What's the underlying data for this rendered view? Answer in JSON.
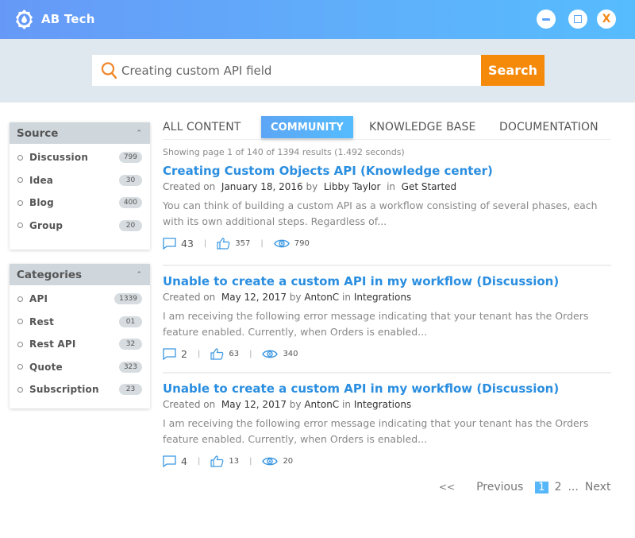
{
  "app": {
    "title": "AB Tech",
    "window_controls": {
      "minimize": "minimize",
      "maximize": "maximize",
      "close": "X"
    }
  },
  "search": {
    "value": "Creating custom API field",
    "button_label": "Search"
  },
  "sidebar": {
    "source": {
      "title": "Source",
      "items": [
        {
          "label": "Discussion",
          "count": "799"
        },
        {
          "label": "Idea",
          "count": "30"
        },
        {
          "label": "Blog",
          "count": "400"
        },
        {
          "label": "Group",
          "count": "20"
        }
      ]
    },
    "categories": {
      "title": "Categories",
      "items": [
        {
          "label": "API",
          "count": "1339"
        },
        {
          "label": "Rest",
          "count": "01"
        },
        {
          "label": "Rest API",
          "count": "32"
        },
        {
          "label": "Quote",
          "count": "323"
        },
        {
          "label": "Subscription",
          "count": "23"
        }
      ]
    }
  },
  "tabs": [
    {
      "label": "ALL CONTENT",
      "active": false
    },
    {
      "label": "COMMUNITY",
      "active": true
    },
    {
      "label": "KNOWLEDGE BASE",
      "active": false
    },
    {
      "label": "DOCUMENTATION",
      "active": false
    }
  ],
  "results_summary": "Showing page 1 of 140 of 1394 results (1.492 seconds)",
  "results": [
    {
      "title": "Creating Custom Objects API (Knowledge center)",
      "created_on_label": "Created on",
      "date": "January 18, 2016",
      "by_label": "by",
      "author": "Libby Taylor",
      "in_label": "in",
      "category": "Get Started",
      "snippet": "You can think of building a custom API as a workflow consisting of several phases, each with its own additional steps. Regardless of...",
      "comments": "43",
      "likes": "357",
      "views": "790"
    },
    {
      "title": "Unable to create a custom API in my workflow (Discussion)",
      "created_on_label": "Created on",
      "date": "May 12, 2017",
      "by_label": "by",
      "author": "AntonC",
      "in_label": "in",
      "category": "Integrations",
      "snippet": "I am receiving the following error message indicating that your tenant has the Orders feature enabled. Currently, when Orders is enabled...",
      "comments": "2",
      "likes": "63",
      "views": "340"
    },
    {
      "title": "Unable to create a custom API in my workflow (Discussion)",
      "created_on_label": "Created on",
      "date": "May 12, 2017",
      "by_label": "by",
      "author": "AntonC",
      "in_label": "in",
      "category": "Integrations",
      "snippet": "I am receiving the following error message indicating that your tenant has the Orders feature enabled. Currently, when Orders is enabled...",
      "comments": "4",
      "likes": "13",
      "views": "20"
    }
  ],
  "pagination": {
    "first": "<<",
    "previous": "Previous",
    "pages": [
      "1",
      "2"
    ],
    "current": "1",
    "ellipsis": "...",
    "next": "Next"
  },
  "colors": {
    "header_gradient_start": "#6699f7",
    "header_gradient_end": "#56bcfd",
    "accent_orange": "#f5890a",
    "link_blue": "#2a8ee0",
    "search_band": "#dfe8ef"
  }
}
